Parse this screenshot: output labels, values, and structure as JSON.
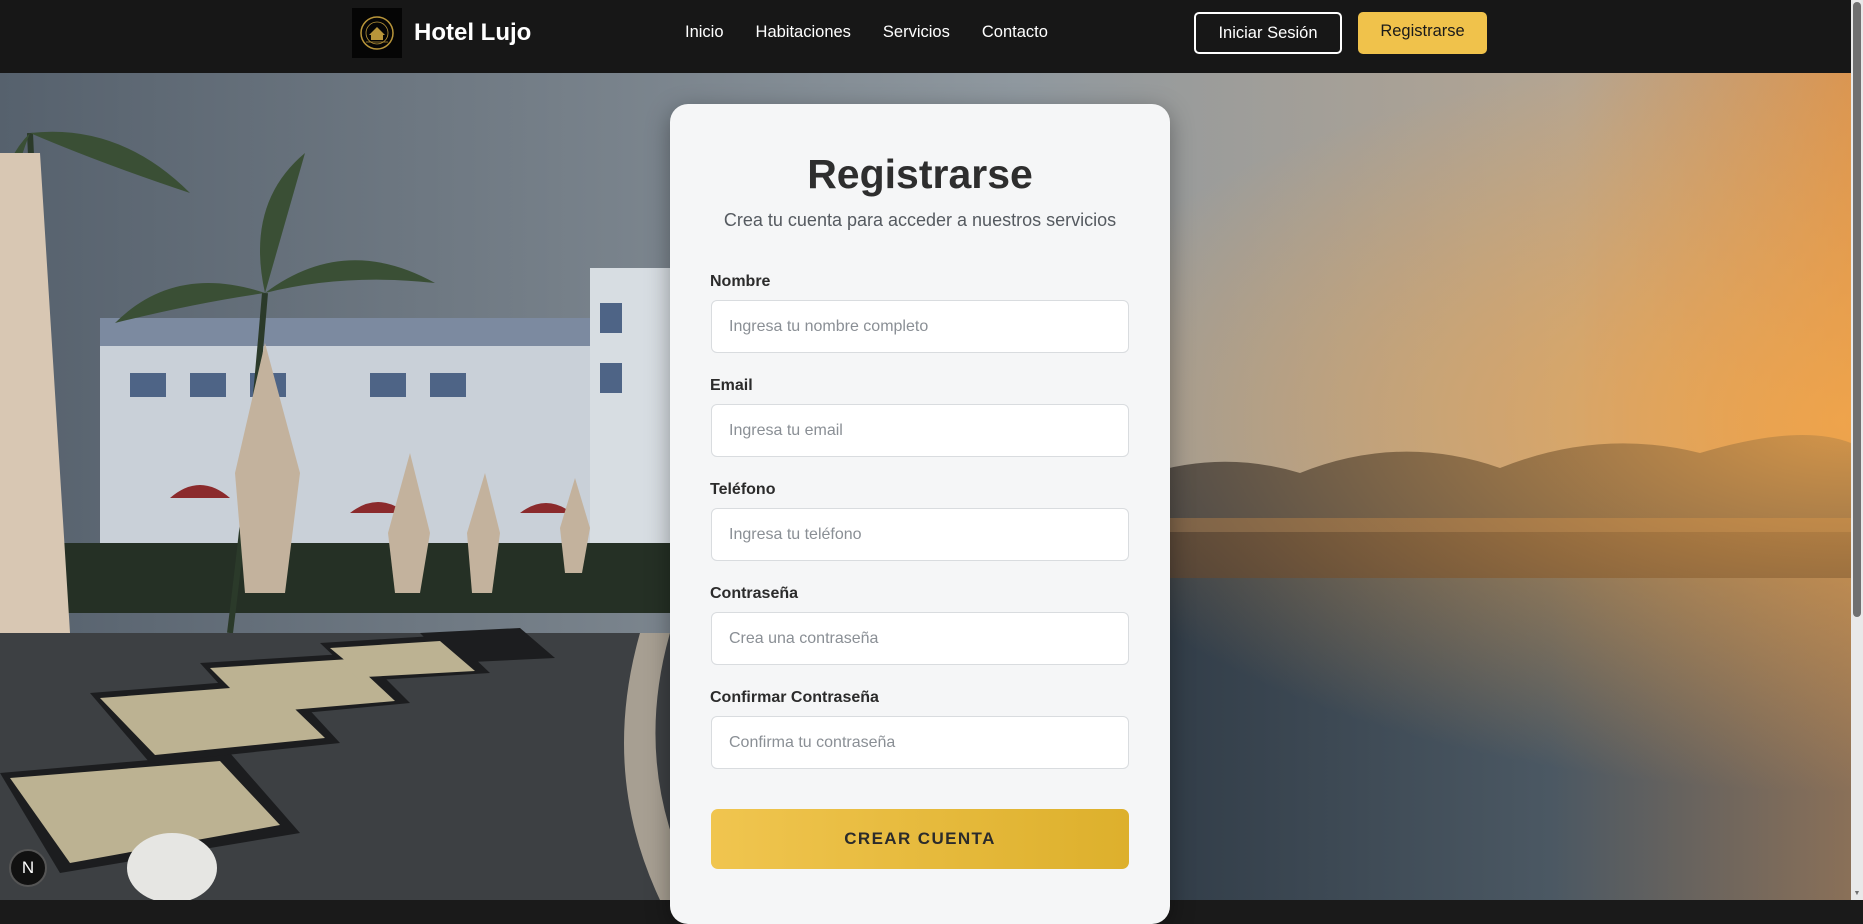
{
  "header": {
    "brand": "Hotel Lujo",
    "logo_icon": "hotel-crest-icon",
    "nav": [
      {
        "label": "Inicio"
      },
      {
        "label": "Habitaciones"
      },
      {
        "label": "Servicios"
      },
      {
        "label": "Contacto"
      }
    ],
    "login_label": "Iniciar Sesión",
    "register_label": "Registrarse"
  },
  "form": {
    "title": "Registrarse",
    "subtitle": "Crea tu cuenta para acceder a nuestros servicios",
    "fields": [
      {
        "label": "Nombre",
        "placeholder": "Ingresa tu nombre completo",
        "value": ""
      },
      {
        "label": "Email",
        "placeholder": "Ingresa tu email",
        "value": ""
      },
      {
        "label": "Teléfono",
        "placeholder": "Ingresa tu teléfono",
        "value": ""
      },
      {
        "label": "Contraseña",
        "placeholder": "Crea una contraseña",
        "value": ""
      },
      {
        "label": "Confirmar Contraseña",
        "placeholder": "Confirma tu contraseña",
        "value": ""
      }
    ],
    "submit_label": "CREAR CUENTA"
  },
  "badge": {
    "label": "N"
  },
  "colors": {
    "navbar": "#171717",
    "accent": "#f0c24b",
    "card": "#f5f6f7",
    "text_dark": "#2e2e2e"
  }
}
